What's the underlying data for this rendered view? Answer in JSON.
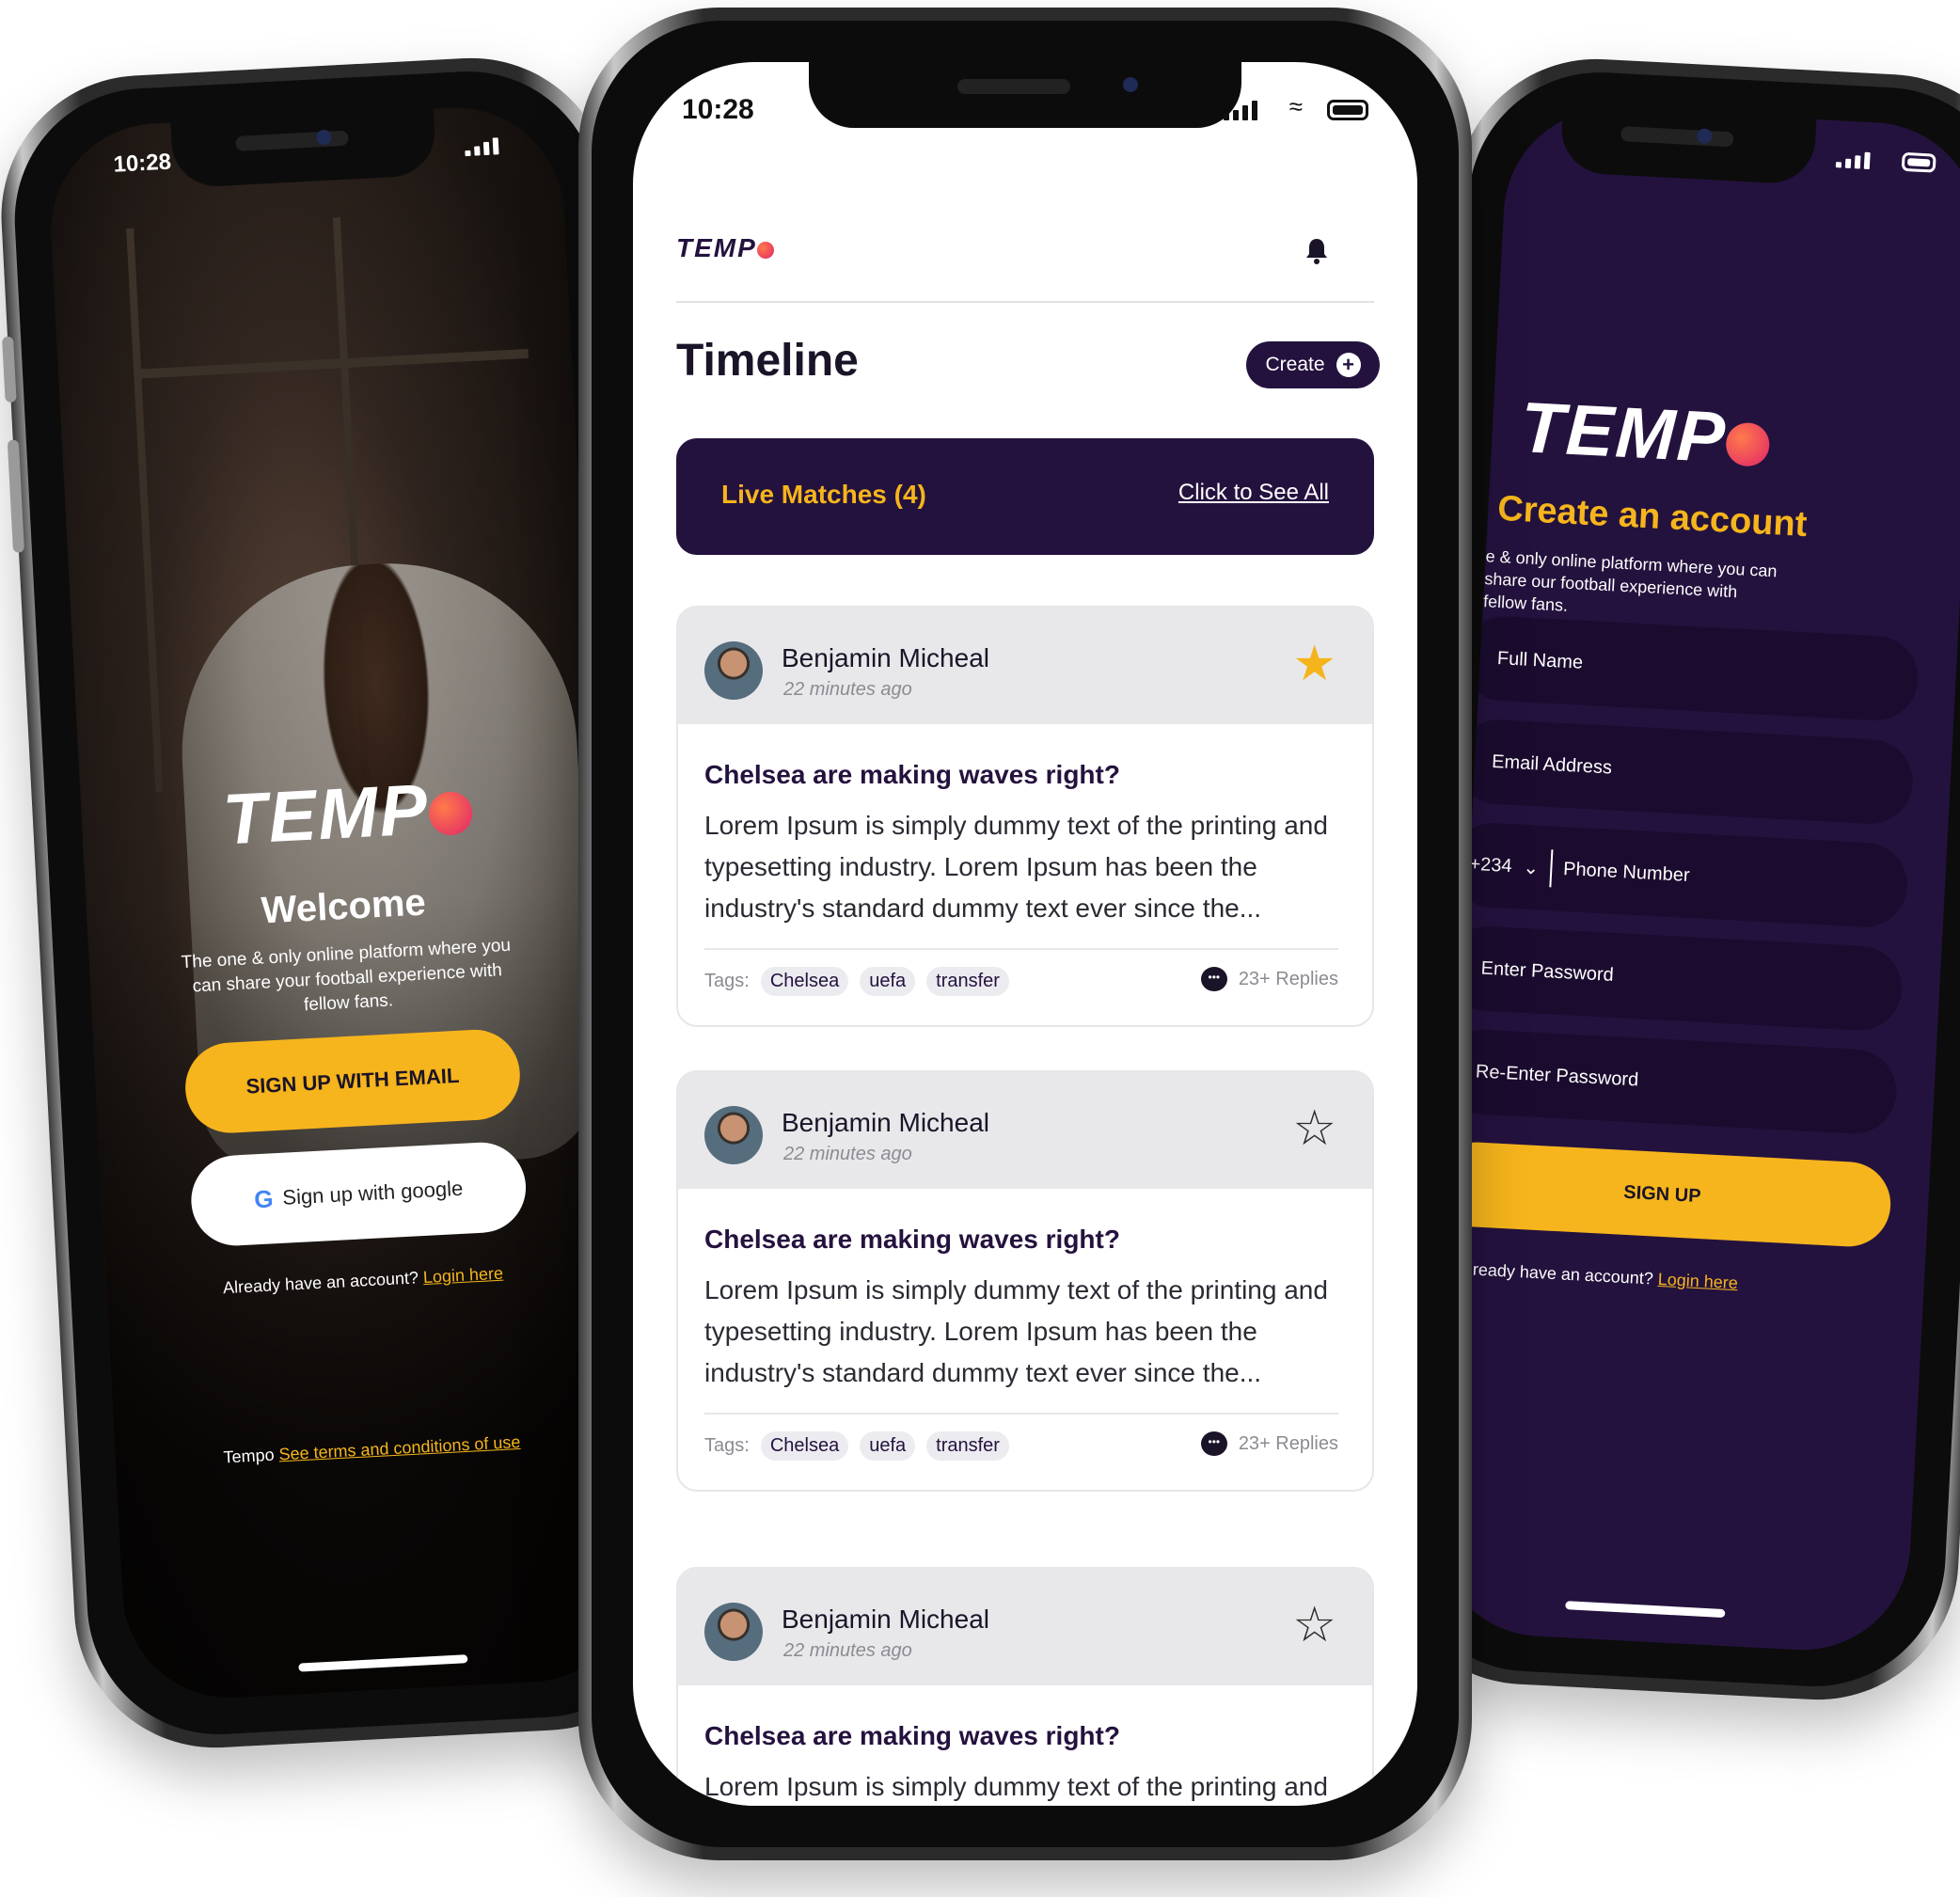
{
  "center": {
    "status_time": "10:28",
    "logo_text": "TEMP",
    "title": "Timeline",
    "create_label": "Create",
    "live_label": "Live Matches  (4)",
    "see_all": "Click to See All",
    "posts": [
      {
        "author": "Benjamin Micheal",
        "time": "22 minutes ago",
        "favorited": true,
        "title": "Chelsea are making waves right?",
        "body": "Lorem Ipsum is simply dummy text of the printing and typesetting industry. Lorem Ipsum has been the industry's standard dummy text ever since the...",
        "tags_label": "Tags:",
        "tags": [
          "Chelsea",
          "uefa",
          "transfer"
        ],
        "replies": "23+ Replies"
      },
      {
        "author": "Benjamin Micheal",
        "time": "22 minutes ago",
        "favorited": false,
        "title": "Chelsea are making waves right?",
        "body": "Lorem Ipsum is simply dummy text of the printing and typesetting industry. Lorem Ipsum has been the industry's standard dummy text ever since the...",
        "tags_label": "Tags:",
        "tags": [
          "Chelsea",
          "uefa",
          "transfer"
        ],
        "replies": "23+ Replies"
      },
      {
        "author": "Benjamin Micheal",
        "time": "22 minutes ago",
        "favorited": false,
        "title": "Chelsea are making waves right?",
        "body": "Lorem Ipsum is simply dummy text of the printing and typesetting industry. Lorem Ipsum has been the"
      }
    ],
    "icons": {
      "notification": "bell-icon",
      "create": "plus-circle-icon",
      "favorite": "star-icon",
      "replies": "chat-bubble-icon"
    }
  },
  "left": {
    "status_time": "10:28",
    "logo_text": "TEMP",
    "welcome": "Welcome",
    "tagline": "The one & only online platform where you can share your football experience with fellow fans.",
    "email_button": "SIGN UP WITH EMAIL",
    "google_button": "Sign up with google",
    "have_account": "Already have an account?",
    "login_link": "Login here",
    "terms_prefix": "Tempo",
    "terms_link": "See terms and conditions of use"
  },
  "right": {
    "logo_text": "TEMP",
    "heading": "Create an account",
    "tagline": "e & only online platform where you can share our football experience with fellow fans.",
    "fields": {
      "full_name": "Full Name",
      "email": "Email Address",
      "country_code": "+234",
      "phone": "Phone Number",
      "password": "Enter Password",
      "re_password": "Re-Enter Password"
    },
    "signup_button": "SIGN UP",
    "have_account": "Already have an account?",
    "login_link": "Login here"
  },
  "colors": {
    "brand_purple": "#24123e",
    "accent_yellow": "#f6b51c",
    "logo_ball": "#e0246a"
  }
}
